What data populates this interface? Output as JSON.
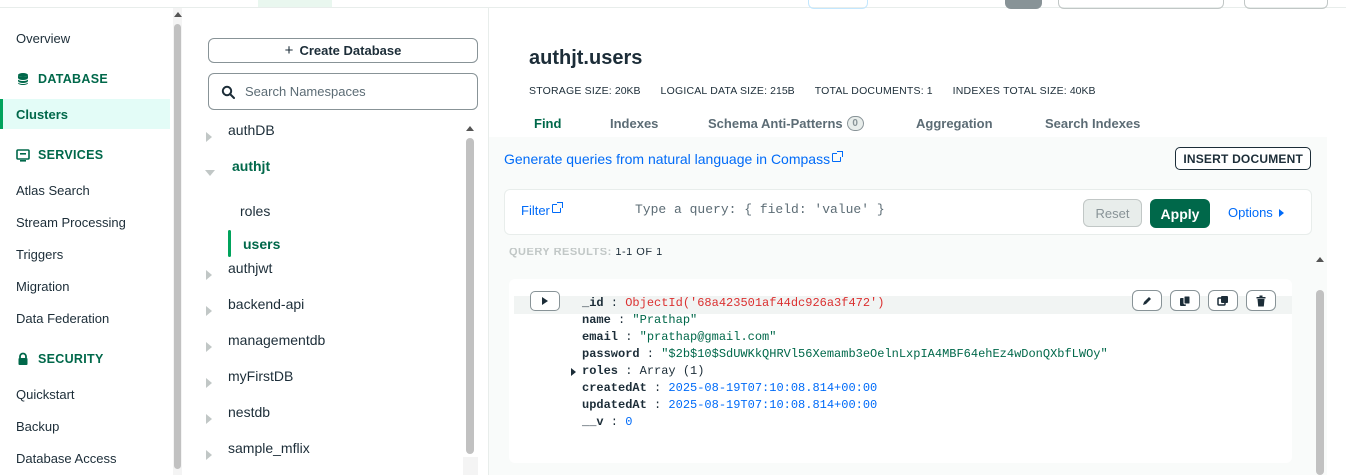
{
  "colors": {
    "accent": "#00684a",
    "link": "#016bf8",
    "active_bg": "#e3fcf7",
    "oid": "#db3030"
  },
  "left_nav": {
    "overview": "Overview",
    "database_header": "DATABASE",
    "clusters": "Clusters",
    "services_header": "SERVICES",
    "services": [
      "Atlas Search",
      "Stream Processing",
      "Triggers",
      "Migration",
      "Data Federation"
    ],
    "security_header": "SECURITY",
    "security": [
      "Quickstart",
      "Backup",
      "Database Access"
    ]
  },
  "namespaces": {
    "create_db_label": "Create Database",
    "search_placeholder": "Search Namespaces",
    "databases": [
      "authDB",
      "authjt",
      "authjwt",
      "backend-api",
      "managementdb",
      "myFirstDB",
      "nestdb",
      "sample_mflix"
    ],
    "expanded_db": "authjt",
    "collections": [
      "roles",
      "users"
    ],
    "active_collection": "users"
  },
  "collection": {
    "title": "authjt.users",
    "stats": [
      {
        "key": "STORAGE SIZE:",
        "value": "20KB"
      },
      {
        "key": "LOGICAL DATA SIZE:",
        "value": "215B"
      },
      {
        "key": "TOTAL DOCUMENTS:",
        "value": "1"
      },
      {
        "key": "INDEXES TOTAL SIZE:",
        "value": "40KB"
      }
    ],
    "tabs": [
      "Find",
      "Indexes",
      "Schema Anti-Patterns",
      "Aggregation",
      "Search Indexes"
    ],
    "anti_patterns_count": "0",
    "active_tab": "Find"
  },
  "find": {
    "nl_link": "Generate queries from natural language in Compass",
    "insert_doc": "INSERT DOCUMENT",
    "filter_label": "Filter",
    "filter_placeholder": "Type a query: { field: 'value' }",
    "reset": "Reset",
    "apply": "Apply",
    "options": "Options",
    "results_label": "QUERY RESULTS:",
    "results_count": "1-1 OF 1"
  },
  "document": {
    "fields": [
      {
        "key": "_id",
        "value": "ObjectId('68a423501af44dc926a3f472')",
        "type": "oid"
      },
      {
        "key": "name",
        "value": "\"Prathap\"",
        "type": "str"
      },
      {
        "key": "email",
        "value": "\"prathap@gmail.com\"",
        "type": "str"
      },
      {
        "key": "password",
        "value": "\"$2b$10$SdUWKkQHRVl56Xemamb3eOelnLxpIA4MBF64ehEz4wDonQXbfLWOy\"",
        "type": "str"
      },
      {
        "key": "roles",
        "value": "Array (1)",
        "type": "arr"
      },
      {
        "key": "createdAt",
        "value": "2025-08-19T07:10:08.814+00:00",
        "type": "date"
      },
      {
        "key": "updatedAt",
        "value": "2025-08-19T07:10:08.814+00:00",
        "type": "date"
      },
      {
        "key": "__v",
        "value": "0",
        "type": "num"
      }
    ]
  }
}
